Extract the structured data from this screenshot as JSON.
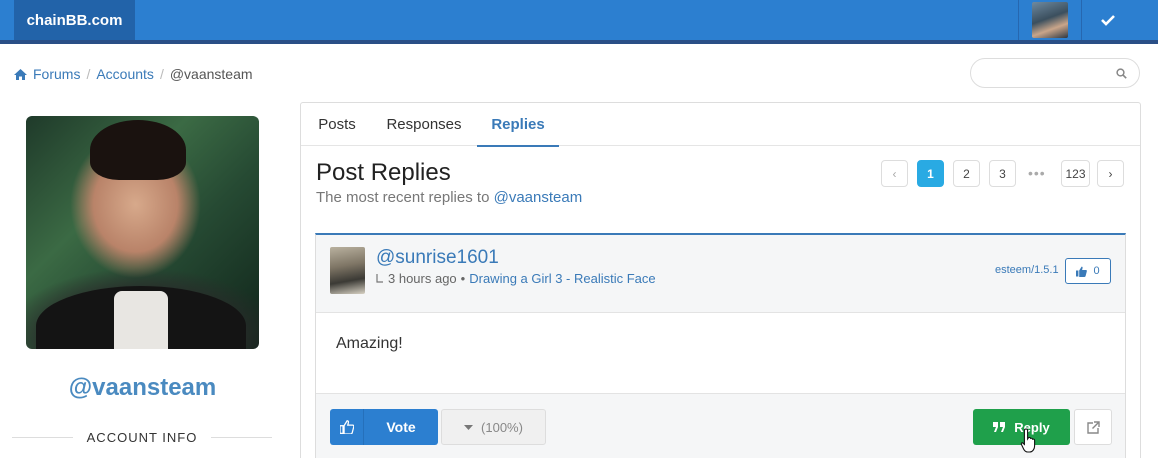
{
  "header": {
    "brand": "chainBB.com",
    "icons": {
      "avatar": "user-avatar",
      "check": "check-icon"
    }
  },
  "breadcrumb": {
    "items": [
      "Forums",
      "Accounts"
    ],
    "current": "@vaansteam",
    "home_icon": "home-icon"
  },
  "search": {
    "placeholder": "",
    "icon": "search-icon"
  },
  "sidebar": {
    "username": "@vaansteam",
    "section_label": "ACCOUNT INFO"
  },
  "tabs": [
    {
      "label": "Posts",
      "active": false
    },
    {
      "label": "Responses",
      "active": false
    },
    {
      "label": "Replies",
      "active": true
    }
  ],
  "main": {
    "title": "Post Replies",
    "subtitle_prefix": "The most recent replies to",
    "subtitle_mention": "@vaansteam"
  },
  "pagination": {
    "prev": "‹",
    "pages": [
      "1",
      "2",
      "3"
    ],
    "current": "1",
    "dots": "•••",
    "last": "123",
    "next": "›"
  },
  "reply": {
    "author": "@sunrise1601",
    "time": "3 hours ago",
    "separator": "•",
    "post_title": "Drawing a Girl 3 - Realistic Face",
    "app": "esteem/1.5.1",
    "likes": "0",
    "body": "Amazing!",
    "vote_label": "Vote",
    "weight": "(100%)",
    "reply_label": "Reply"
  },
  "colors": {
    "topbar": "#2c7fd0",
    "link": "#3a7ab8",
    "active_page": "#29aae3",
    "reply_button": "#1fa04b"
  }
}
